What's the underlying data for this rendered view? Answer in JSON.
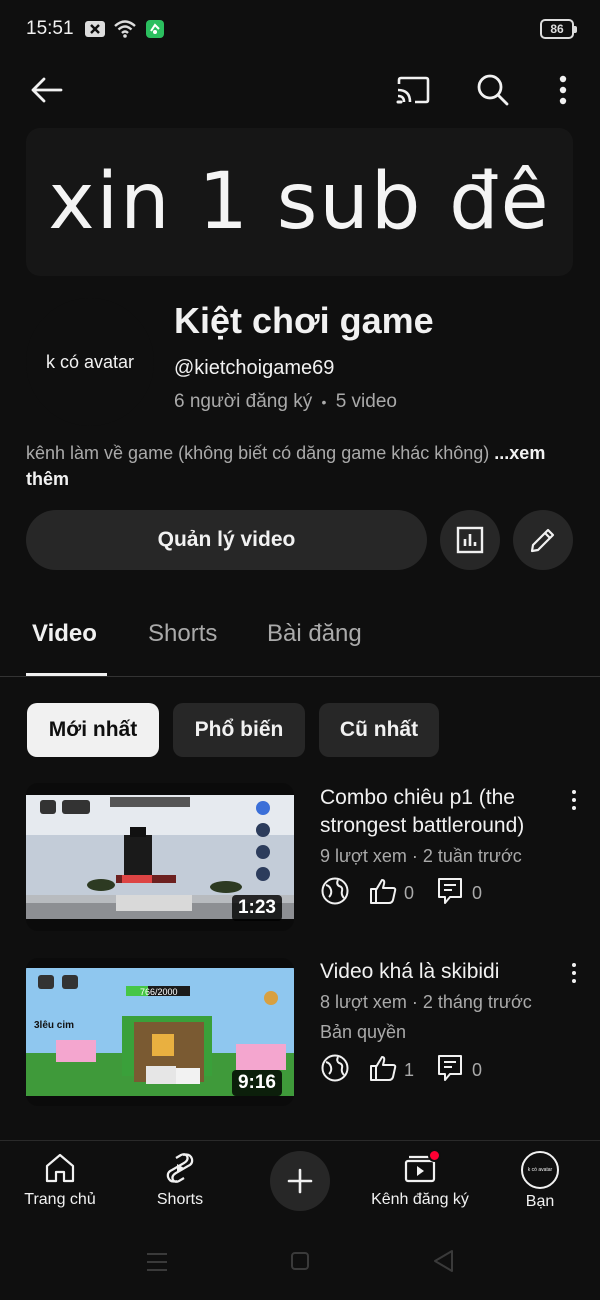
{
  "status_bar": {
    "time": "15:51",
    "battery": "86"
  },
  "banner": {
    "text": "xin 1 sub đê"
  },
  "channel": {
    "avatar_text": "k có avatar",
    "name": "Kiệt chơi game",
    "handle": "@kietchoigame69",
    "subscribers": "6 người đăng ký",
    "separator": "•",
    "video_count": "5 video",
    "description": "kênh làm về game (không biết có dăng game khác không)",
    "see_more": "...xem thêm"
  },
  "actions": {
    "manage_label": "Quản lý video"
  },
  "tabs": [
    {
      "label": "Video"
    },
    {
      "label": "Shorts"
    },
    {
      "label": "Bài đăng"
    }
  ],
  "chips": [
    {
      "label": "Mới nhất"
    },
    {
      "label": "Phổ biến"
    },
    {
      "label": "Cũ nhất"
    }
  ],
  "videos": [
    {
      "title": "Combo chiêu p1 (the strongest battleround)",
      "meta": "9 lượt xem · 2 tuần trước",
      "extra": "",
      "likes": "0",
      "comments": "0",
      "duration": "1:23"
    },
    {
      "title": "Video khá là skibidi",
      "meta": "8 lượt xem · 2 tháng trước",
      "extra": "Bản quyền",
      "likes": "1",
      "comments": "0",
      "duration": "9:16",
      "overlay_text": "766/2000",
      "overlay_label": "3lêu cim"
    }
  ],
  "bottom_nav": [
    {
      "label": "Trang chủ",
      "icon": "home-icon"
    },
    {
      "label": "Shorts",
      "icon": "shorts-icon"
    },
    {
      "label": "",
      "icon": "create-icon"
    },
    {
      "label": "Kênh đăng ký",
      "icon": "subscriptions-icon"
    },
    {
      "label": "Bạn",
      "icon": "you-avatar-icon"
    }
  ],
  "colors": {
    "background": "#0f0f0f",
    "surface": "#272727",
    "text": "#f1f1f1",
    "muted": "#aaaaaa",
    "badge": "#ff0033"
  }
}
